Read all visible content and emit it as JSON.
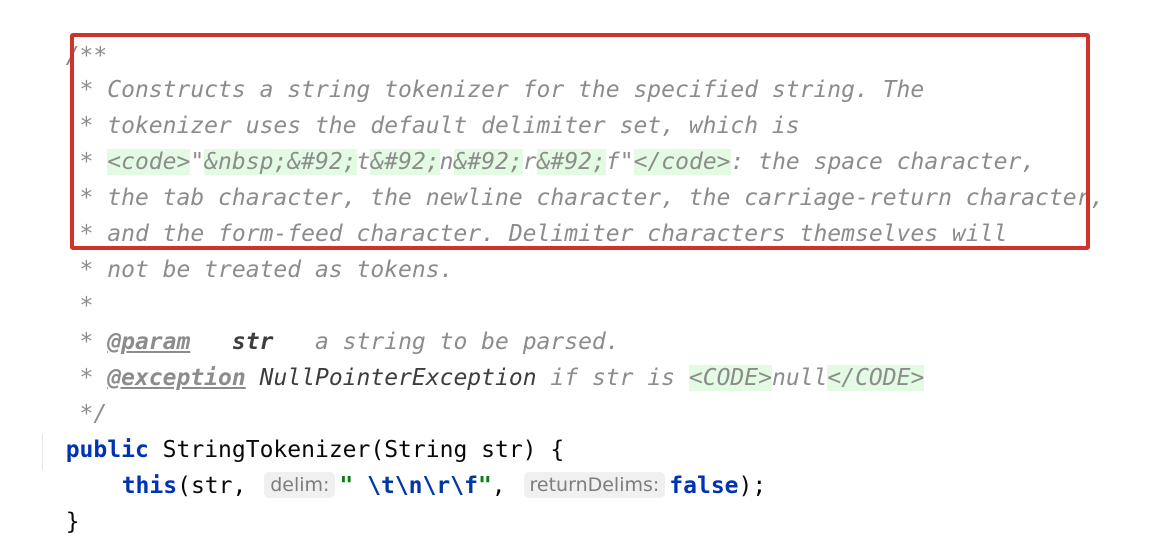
{
  "doc": {
    "open": "/**",
    "star": " * ",
    "line1": "Constructs a string tokenizer for the specified string. The",
    "line2": "tokenizer uses the default delimiter set, which is",
    "line3": {
      "code_open": "<code>",
      "q1": "\"",
      "nbsp": "&nbsp;",
      "bs1": "&#92;",
      "t": "t",
      "bs2": "&#92;",
      "n": "n",
      "bs3": "&#92;",
      "r": "r",
      "bs4": "&#92;",
      "f": "f",
      "q2": "\"",
      "code_close": "</code>",
      "rest": ": the space character,"
    },
    "line4": "the tab character, the newline character, the carriage-return character,",
    "line5": "and the form-feed character. Delimiter characters themselves will",
    "line6": "not be treated as tokens.",
    "blank_star": " *",
    "param_tag": "@param",
    "param_name": "str",
    "param_desc": "a string to be parsed.",
    "exception_tag": "@exception",
    "exception_name": "NullPointerException",
    "exception_desc": "if str is",
    "code_upper_open": "<CODE>",
    "null_text": "null",
    "code_upper_close": "</CODE>",
    "close": " */"
  },
  "code": {
    "kw_public": "public",
    "signature": "StringTokenizer(String str) {",
    "kw_this": "this",
    "call_open": "(str,",
    "hint_delim": "delim:",
    "str_quote_open": "\" ",
    "esc_t": "\\t",
    "esc_n": "\\n",
    "esc_r": "\\r",
    "esc_f": "\\f",
    "str_quote_close": "\"",
    "comma": ",",
    "hint_return": "returnDelims:",
    "kw_false": "false",
    "call_close": ");",
    "closing_brace": "}"
  }
}
